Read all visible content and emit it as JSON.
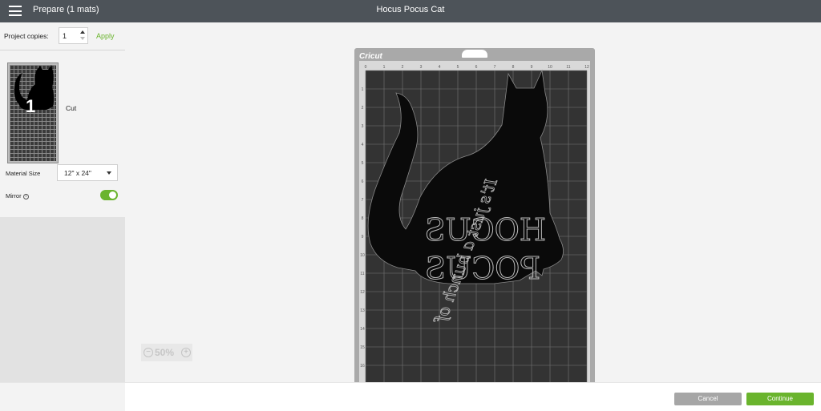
{
  "header": {
    "left_title": "Prepare (1 mats)",
    "project_title": "Hocus Pocus Cat"
  },
  "sidebar": {
    "copies_label": "Project copies:",
    "copies_value": "1",
    "apply_label": "Apply",
    "mat": {
      "number": "1",
      "type_label": "Cut"
    },
    "material_size_label": "Material Size",
    "material_size_value": "12\" x 24\"",
    "mirror_label": "Mirror",
    "mirror_on": true
  },
  "canvas": {
    "brand": "Cricut",
    "ruler_top": [
      "0",
      "1",
      "2",
      "3",
      "4",
      "5",
      "6",
      "7",
      "8",
      "9",
      "10",
      "11",
      "12"
    ],
    "ruler_left": [
      "1",
      "2",
      "3",
      "4",
      "5",
      "6",
      "7",
      "8",
      "9",
      "10",
      "11",
      "12",
      "13",
      "14",
      "15",
      "16",
      "17"
    ],
    "design_lines": [
      "It's just a bunch of",
      "HOCUS",
      "POCUS"
    ],
    "zoom_level": "50%"
  },
  "footer": {
    "cancel_label": "Cancel",
    "continue_label": "Continue"
  },
  "colors": {
    "header_bg": "#4d5359",
    "accent_green": "#6ab42d",
    "mat_dark": "#333333",
    "mat_frame": "#a9a9a9"
  }
}
